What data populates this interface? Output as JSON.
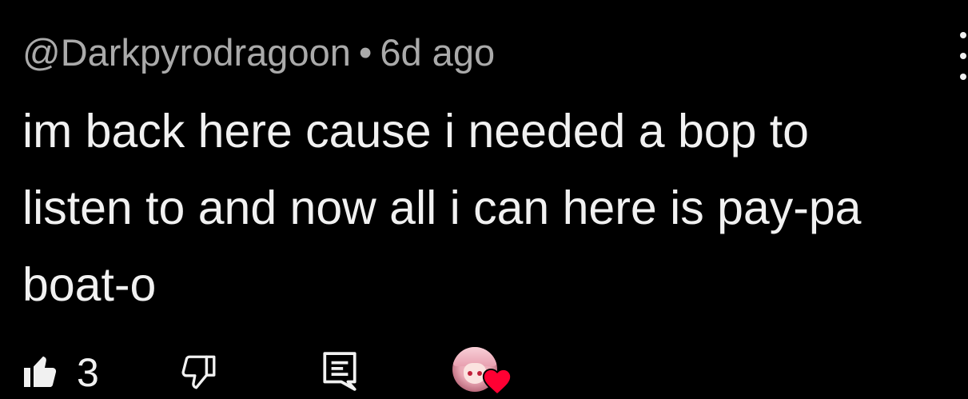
{
  "comment": {
    "author": "@Darkpyrodragoon",
    "separator": "•",
    "timestamp": "6d ago",
    "text": "im back here cause i needed a bop to\nlisten to and now all i can here is pay-pa\nboat-o"
  },
  "actions": {
    "like_count": "3"
  },
  "icons": {
    "like": "thumbs-up-icon",
    "dislike": "thumbs-down-icon",
    "reply": "reply-comment-icon",
    "menu": "more-vert-icon",
    "heart": "creator-heart-icon"
  },
  "colors": {
    "background": "#000000",
    "text": "#f1f1f1",
    "secondary_text": "#aaaaaa",
    "heart": "#ff0033"
  }
}
